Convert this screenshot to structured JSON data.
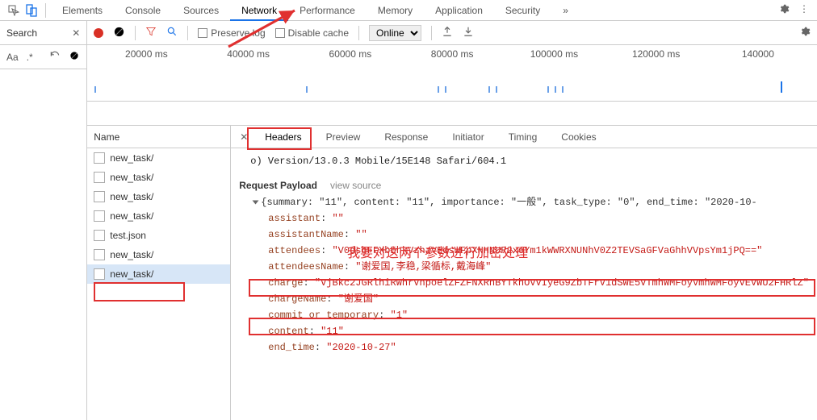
{
  "topTabs": {
    "items": [
      "Elements",
      "Console",
      "Sources",
      "Network",
      "Performance",
      "Memory",
      "Application",
      "Security"
    ],
    "activeIndex": 3
  },
  "search": {
    "title": "Search",
    "aa": "Aa",
    "regex": ".*"
  },
  "toolbar": {
    "preserve": "Preserve log",
    "disableCache": "Disable cache",
    "online": "Online"
  },
  "timeline": {
    "labels": [
      "20000 ms",
      "40000 ms",
      "60000 ms",
      "80000 ms",
      "100000 ms",
      "120000 ms",
      "140000"
    ]
  },
  "nameCol": {
    "header": "Name",
    "items": [
      "new_task/",
      "new_task/",
      "new_task/",
      "new_task/",
      "test.json",
      "new_task/",
      "new_task/"
    ],
    "selectedIndex": 6
  },
  "detailTabs": {
    "items": [
      "Headers",
      "Preview",
      "Response",
      "Initiator",
      "Timing",
      "Cookies"
    ],
    "activeIndex": 0
  },
  "userAgent": "o) Version/13.0.3 Mobile/15E148 Safari/604.1",
  "payload": {
    "title": "Request Payload",
    "viewSource": "view source",
    "summaryLine": "{summary: \"11\", content: \"11\", importance: \"一般\", task_type: \"0\", end_time: \"2020-10-",
    "fields": {
      "assistant": "\"\"",
      "assistantName": "\"\"",
      "attendees": "\"V0dsbFFXbEhkVzhzVEdsWFpXNHNUR2xoYm1kWWRXNUNhV0Z2TEVSaGFVaGhhVVpsYm1jPQ==\"",
      "attendeesName": "\"谢爱国,李稳,梁循标,戴海峰\"",
      "charge": "\"VjBkc2JGRlhiRWhrVnpoelZFZFNXRnBYTkhOVVIyeG9ZbTFrV1dSWE5VTmhWMFoyVmhWMFoyVEVWU2FHRlZ\"",
      "chargeName": "\"谢爱国\"",
      "commit_or_temporary": "\"1\"",
      "content": "\"11\"",
      "end_time": "\"2020-10-27\""
    }
  },
  "annotation": "我要对这两个参数进行加密处理"
}
